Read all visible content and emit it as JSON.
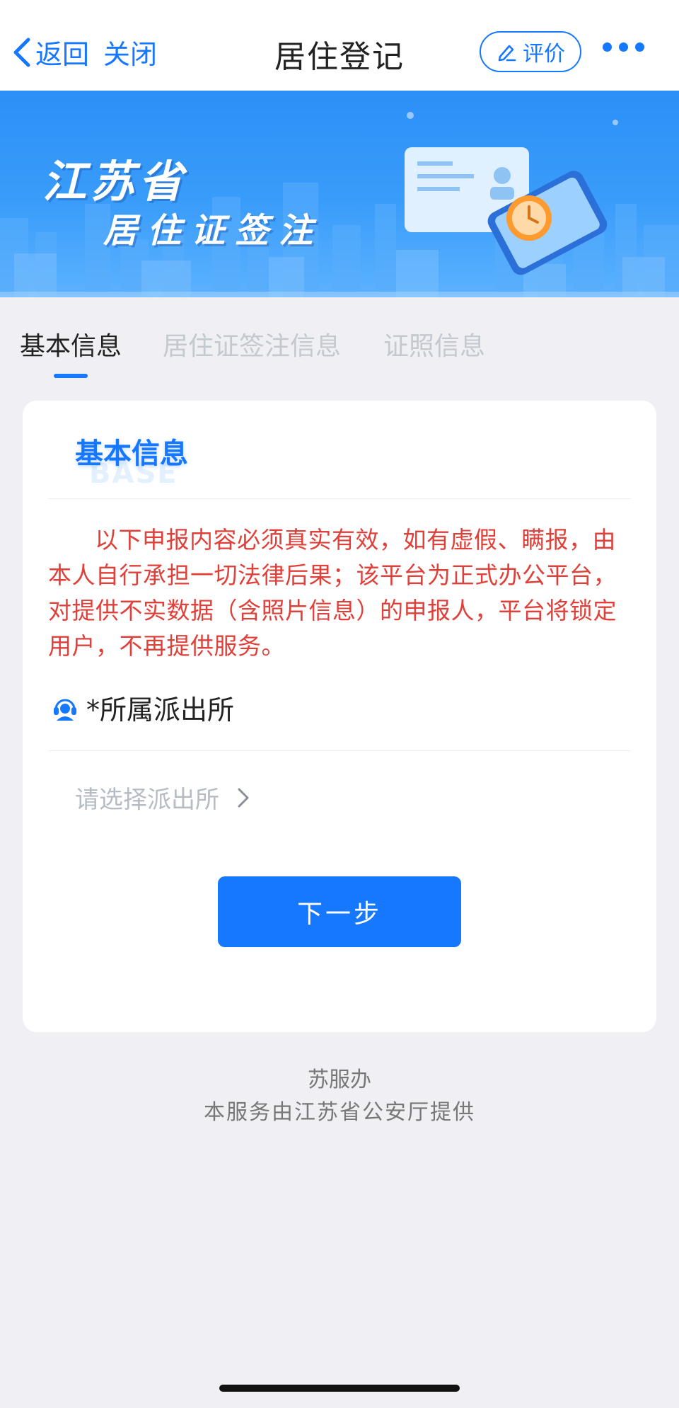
{
  "nav": {
    "back_label": "返回",
    "close_label": "关闭",
    "title": "居住登记",
    "rate_label": "评价"
  },
  "banner": {
    "title_line1": "江苏省",
    "title_line2": "居住证签注"
  },
  "tabs": [
    {
      "label": "基本信息",
      "active": true
    },
    {
      "label": "居住证签注信息",
      "active": false
    },
    {
      "label": "证照信息",
      "active": false
    }
  ],
  "card": {
    "section_title": "基本信息",
    "section_subtitle": "BASE",
    "notice": "以下申报内容必须真实有效，如有虚假、瞒报，由本人自行承担一切法律后果；该平台为正式办公平台，对提供不实数据（含照片信息）的申报人，平台将锁定用户，不再提供服务。",
    "field_label": "*所属派出所",
    "select_placeholder": "请选择派出所",
    "next_button": "下一步"
  },
  "footer": {
    "line1": "苏服办",
    "line2": "本服务由江苏省公安厅提供"
  },
  "colors": {
    "accent": "#1677ff",
    "warning_text": "#e0403a",
    "background": "#efeff4"
  }
}
